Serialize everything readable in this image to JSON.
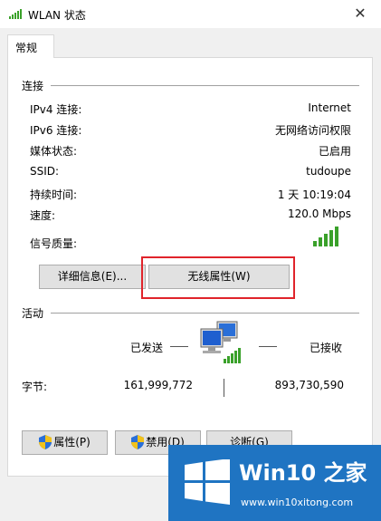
{
  "window": {
    "title": "WLAN 状态",
    "close_glyph": "✕"
  },
  "tabs": [
    {
      "label": "常规"
    }
  ],
  "connection": {
    "section_label": "连接",
    "rows": [
      {
        "label": "IPv4 连接:",
        "value": "Internet"
      },
      {
        "label": "IPv6 连接:",
        "value": "无网络访问权限"
      },
      {
        "label": "媒体状态:",
        "value": "已启用"
      },
      {
        "label": "SSID:",
        "value": "tudoupe"
      },
      {
        "label": "持续时间:",
        "value": "1 天 10:19:04"
      },
      {
        "label": "速度:",
        "value": "120.0 Mbps"
      },
      {
        "label": "信号质量:",
        "icon": "signal-bars-icon",
        "signal_level": "5/5"
      }
    ],
    "buttons": {
      "details": "详细信息(E)...",
      "wireless_props": "无线属性(W)"
    }
  },
  "activity": {
    "section_label": "活动",
    "sent_label": "已发送",
    "received_label": "已接收",
    "bytes_label": "字节:",
    "bytes_sent": "161,999,772",
    "bytes_received": "893,730,590"
  },
  "footer_buttons": {
    "properties": "属性(P)",
    "disable": "禁用(D)",
    "diagnose": "诊断(G)"
  },
  "watermark": {
    "brand": "Win10 之家",
    "url": "www.win10xitong.com"
  },
  "colors": {
    "highlight": "#e0242b",
    "signal_green": "#3aa12a",
    "logo_blue": "#1f74c2"
  }
}
